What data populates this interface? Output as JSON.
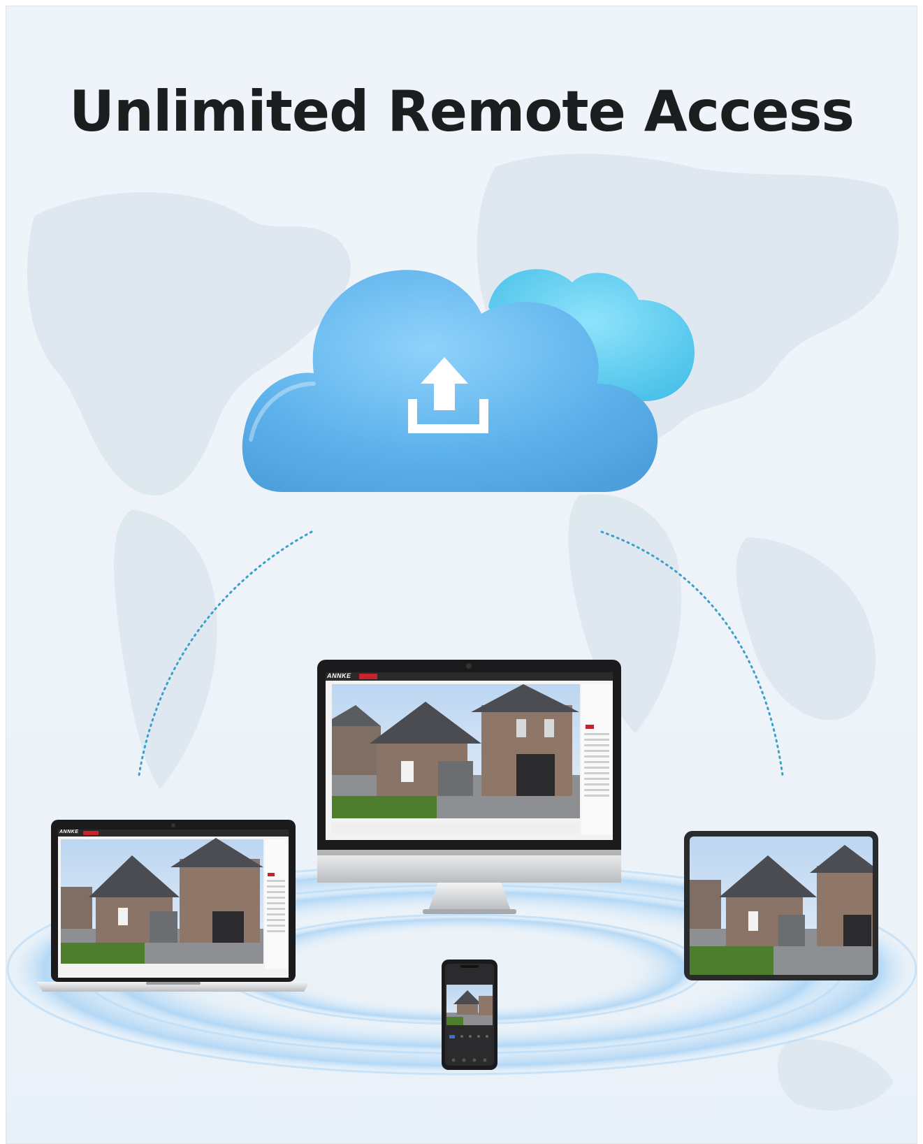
{
  "headline": "Unlimited Remote Access",
  "app": {
    "logo_text": "ANNKE",
    "accent": "#c8232c"
  },
  "icons": {
    "cloud": "cloud-icon",
    "upload": "upload-icon"
  },
  "colors": {
    "background": "#edf3f8",
    "cloud_main": "#62b4ec",
    "cloud_back": "#5cc8ec",
    "dots": "#3aa0c8",
    "ripple": "#a9d3f4"
  },
  "devices": [
    {
      "name": "desktop-monitor"
    },
    {
      "name": "laptop"
    },
    {
      "name": "tablet"
    },
    {
      "name": "smartphone"
    }
  ]
}
